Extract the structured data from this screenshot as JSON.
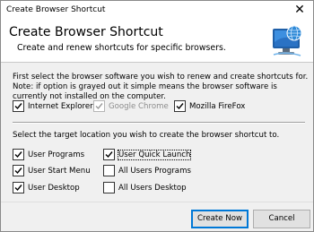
{
  "window": {
    "title": "Create Browser Shortcut",
    "close_glyph": "✕"
  },
  "header": {
    "title": "Create Browser Shortcut",
    "subtitle": "Create and renew shortcuts for specific browsers.",
    "logo_icon": "monitor-with-globe-icon"
  },
  "intro": "First select the browser software you wish to renew and create shortcuts for. Note: if option is grayed out it simple means the browser software is currently not installed on the computer.",
  "browsers": [
    {
      "label": "Internet Explorer",
      "checked": true,
      "disabled": false
    },
    {
      "label": "Google Chrome",
      "checked": true,
      "disabled": true
    },
    {
      "label": "Mozilla FireFox",
      "checked": true,
      "disabled": false
    }
  ],
  "target_intro": "Select the target location you wish to create the browser shortcut to.",
  "targets": [
    {
      "label": "User Programs",
      "checked": true
    },
    {
      "label": "User Quick Launch",
      "checked": true,
      "focused": true
    },
    {
      "label": "User Start Menu",
      "checked": true
    },
    {
      "label": "All Users Programs",
      "checked": false
    },
    {
      "label": "User Desktop",
      "checked": true
    },
    {
      "label": "All Users Desktop",
      "checked": false
    }
  ],
  "buttons": {
    "create": "Create Now",
    "cancel": "Cancel"
  },
  "colors": {
    "accent": "#0078d7",
    "window_bg": "#f0f0f0",
    "disabled_text": "#8c8c8c"
  }
}
